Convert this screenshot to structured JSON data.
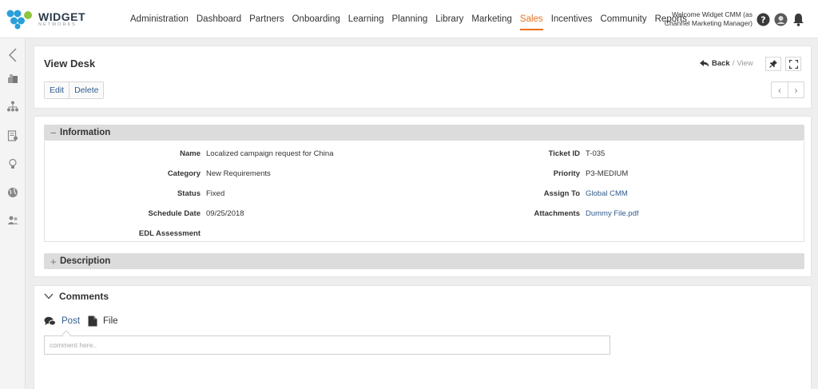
{
  "header": {
    "logo": {
      "name": "WIDGET",
      "sub": "NETWORKS"
    },
    "nav": [
      {
        "label": "Administration",
        "active": false
      },
      {
        "label": "Dashboard",
        "active": false
      },
      {
        "label": "Partners",
        "active": false
      },
      {
        "label": "Onboarding",
        "active": false
      },
      {
        "label": "Learning",
        "active": false
      },
      {
        "label": "Planning",
        "active": false
      },
      {
        "label": "Library",
        "active": false
      },
      {
        "label": "Marketing",
        "active": false
      },
      {
        "label": "Sales",
        "active": true
      },
      {
        "label": "Incentives",
        "active": false
      },
      {
        "label": "Community",
        "active": false
      },
      {
        "label": "Reports",
        "active": false
      }
    ],
    "welcome_line1": "Welcome Widget CMM (as",
    "welcome_line2": "Channel Marketing Manager)",
    "icons": [
      "help-icon",
      "user-avatar-icon",
      "bell-icon"
    ]
  },
  "sidebar": {
    "icons": [
      "collapse-chevron-icon",
      "boxes-icon",
      "hierarchy-icon",
      "certificate-icon",
      "lightbulb-icon",
      "globe-icon",
      "users-icon"
    ]
  },
  "view": {
    "title": "View Desk",
    "edit_label": "Edit",
    "delete_label": "Delete",
    "back_label": "Back",
    "breadcrumb_current": "View"
  },
  "information": {
    "title": "Information",
    "left": [
      {
        "label": "Name",
        "value": "Localized campaign request for China"
      },
      {
        "label": "Category",
        "value": "New Requirements"
      },
      {
        "label": "Status",
        "value": "Fixed"
      },
      {
        "label": "Schedule Date",
        "value": "09/25/2018"
      },
      {
        "label": "EDL Assessment",
        "value": ""
      }
    ],
    "right": [
      {
        "label": "Ticket ID",
        "value": "T-035"
      },
      {
        "label": "Priority",
        "value": "P3-MEDIUM"
      },
      {
        "label": "Assign To",
        "value": "Global CMM"
      },
      {
        "label": "Attachments",
        "value": "Dummy File.pdf"
      }
    ]
  },
  "description": {
    "title": "Description"
  },
  "comments": {
    "title": "Comments",
    "tab_post": "Post",
    "tab_file": "File",
    "placeholder": "comment here.."
  },
  "colors": {
    "accent": "#e8711f",
    "link": "#2f5d8c",
    "section_bar": "#dcdcdc"
  }
}
